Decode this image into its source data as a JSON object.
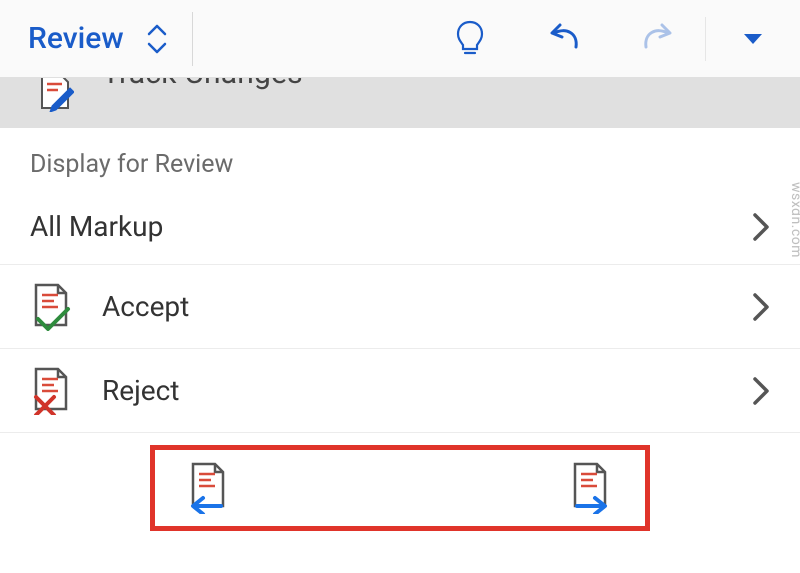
{
  "toolbar": {
    "tab_label": "Review"
  },
  "peek": {
    "label": "Track Changes"
  },
  "section": {
    "display_for_review": "Display for Review"
  },
  "rows": {
    "all_markup": "All Markup",
    "accept": "Accept",
    "reject": "Reject"
  },
  "watermark": "wsxdn.com"
}
